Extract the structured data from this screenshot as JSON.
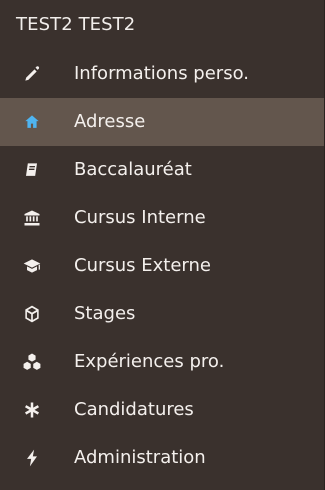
{
  "sidebar": {
    "user_name": "TEST2 TEST2",
    "items": [
      {
        "label": "Informations perso.",
        "icon": "pencil-icon",
        "active": false
      },
      {
        "label": "Adresse",
        "icon": "home-icon",
        "active": true
      },
      {
        "label": "Baccalauréat",
        "icon": "book-icon",
        "active": false
      },
      {
        "label": "Cursus Interne",
        "icon": "institution-icon",
        "active": false
      },
      {
        "label": "Cursus Externe",
        "icon": "graduation-cap-icon",
        "active": false
      },
      {
        "label": "Stages",
        "icon": "cube-icon",
        "active": false
      },
      {
        "label": "Expériences pro.",
        "icon": "cubes-icon",
        "active": false
      },
      {
        "label": "Candidatures",
        "icon": "asterisk-icon",
        "active": false
      },
      {
        "label": "Administration",
        "icon": "bolt-icon",
        "active": false
      }
    ]
  },
  "colors": {
    "background": "#3a312d",
    "active_background": "#63564d",
    "text": "#f4f0ed",
    "active_icon": "#4fb4f0"
  }
}
